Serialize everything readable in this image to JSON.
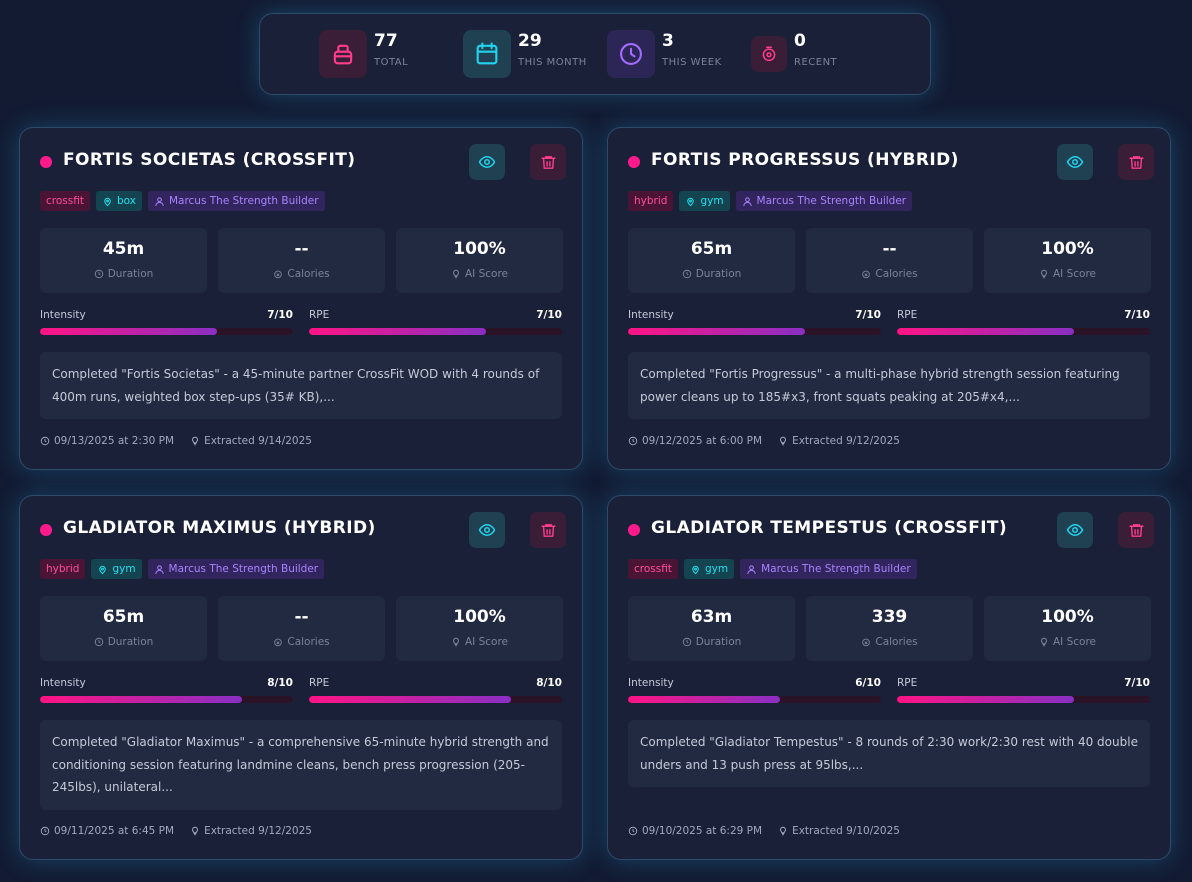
{
  "stats": [
    {
      "value": "77",
      "label": "TOTAL",
      "icon": "weight-icon",
      "color": "#ff3d8b"
    },
    {
      "value": "29",
      "label": "THIS MONTH",
      "icon": "calendar-icon",
      "color": "#22d3ee"
    },
    {
      "value": "3",
      "label": "THIS WEEK",
      "icon": "clock-icon",
      "color": "#a16cff"
    },
    {
      "value": "0",
      "label": "RECENT",
      "icon": "stopwatch-icon",
      "color": "#ff3d8b"
    }
  ],
  "workouts": [
    {
      "title": "FORTIS SOCIETAS (CROSSFIT)",
      "category": "crossfit",
      "location": "box",
      "coach": "Marcus The Strength Builder",
      "duration": "45m",
      "calories": "--",
      "ai_score": "100%",
      "duration_label": "Duration",
      "calories_label": "Calories",
      "ai_score_label": "AI Score",
      "intensity_label": "Intensity",
      "intensity": "7/10",
      "intensity_level": 0.7,
      "rpe_label": "RPE",
      "rpe": "7/10",
      "rpe_level": 0.7,
      "description": "Completed \"Fortis Societas\" - a 45-minute partner CrossFit WOD with 4 rounds of 400m runs, weighted box step-ups (35# KB),...",
      "date": "09/13/2025 at 2:30 PM",
      "extracted": "Extracted 9/14/2025"
    },
    {
      "title": "FORTIS PROGRESSUS (HYBRID)",
      "category": "hybrid",
      "location": "gym",
      "coach": "Marcus The Strength Builder",
      "duration": "65m",
      "calories": "--",
      "ai_score": "100%",
      "duration_label": "Duration",
      "calories_label": "Calories",
      "ai_score_label": "AI Score",
      "intensity_label": "Intensity",
      "intensity": "7/10",
      "intensity_level": 0.7,
      "rpe_label": "RPE",
      "rpe": "7/10",
      "rpe_level": 0.7,
      "description": "Completed \"Fortis Progressus\" - a multi-phase hybrid strength session featuring power cleans up to 185#x3, front squats peaking at 205#x4,...",
      "date": "09/12/2025 at 6:00 PM",
      "extracted": "Extracted 9/12/2025"
    },
    {
      "title": "GLADIATOR MAXIMUS (HYBRID)",
      "category": "hybrid",
      "location": "gym",
      "coach": "Marcus The Strength Builder",
      "duration": "65m",
      "calories": "--",
      "ai_score": "100%",
      "duration_label": "Duration",
      "calories_label": "Calories",
      "ai_score_label": "AI Score",
      "intensity_label": "Intensity",
      "intensity": "8/10",
      "intensity_level": 0.8,
      "rpe_label": "RPE",
      "rpe": "8/10",
      "rpe_level": 0.8,
      "description": "Completed \"Gladiator Maximus\" - a comprehensive 65-minute hybrid strength and conditioning session featuring landmine cleans, bench press progression (205-245lbs), unilateral...",
      "date": "09/11/2025 at 6:45 PM",
      "extracted": "Extracted 9/12/2025"
    },
    {
      "title": "GLADIATOR TEMPESTUS (CROSSFIT)",
      "category": "crossfit",
      "location": "gym",
      "coach": "Marcus The Strength Builder",
      "duration": "63m",
      "calories": "339",
      "ai_score": "100%",
      "duration_label": "Duration",
      "calories_label": "Calories",
      "ai_score_label": "AI Score",
      "intensity_label": "Intensity",
      "intensity": "6/10",
      "intensity_level": 0.6,
      "rpe_label": "RPE",
      "rpe": "7/10",
      "rpe_level": 0.7,
      "description": "Completed \"Gladiator Tempestus\" - 8 rounds of 2:30 work/2:30 rest with 40 double unders and 13 push press at 95lbs,...",
      "date": "09/10/2025 at 6:29 PM",
      "extracted": "Extracted 9/10/2025"
    }
  ],
  "icons": {
    "view": "eye-icon",
    "delete": "trash-icon"
  },
  "colors": {
    "accent_pink": "#ff1a8c",
    "accent_cyan": "#22d3ee",
    "accent_purple": "#a16cff",
    "card_bg": "#1a2038",
    "page_bg": "#131b33"
  }
}
